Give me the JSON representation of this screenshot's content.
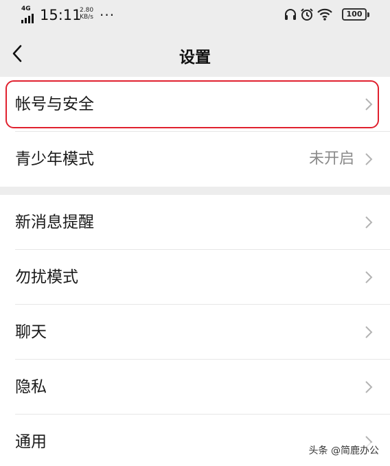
{
  "status_bar": {
    "network": "4G",
    "time": "15:11",
    "speed_value": "2.80",
    "speed_unit": "KB/s",
    "more": "···",
    "battery": "100",
    "icons": [
      "headphone-icon",
      "alarm-icon",
      "wifi-icon",
      "battery-icon"
    ]
  },
  "header": {
    "title": "设置",
    "back_icon": "chevron-left-icon"
  },
  "groups": [
    {
      "items": [
        {
          "label": "帐号与安全",
          "value": "",
          "highlighted": true
        },
        {
          "label": "青少年模式",
          "value": "未开启"
        }
      ]
    },
    {
      "items": [
        {
          "label": "新消息提醒",
          "value": ""
        },
        {
          "label": "勿扰模式",
          "value": ""
        },
        {
          "label": "聊天",
          "value": ""
        },
        {
          "label": "隐私",
          "value": ""
        },
        {
          "label": "通用",
          "value": ""
        }
      ]
    }
  ],
  "watermark": "头条 @简鹿办公",
  "colors": {
    "page_bg": "#ededed",
    "card_bg": "#ffffff",
    "highlight_border": "#e0202e",
    "secondary_text": "#8a8a8a"
  }
}
